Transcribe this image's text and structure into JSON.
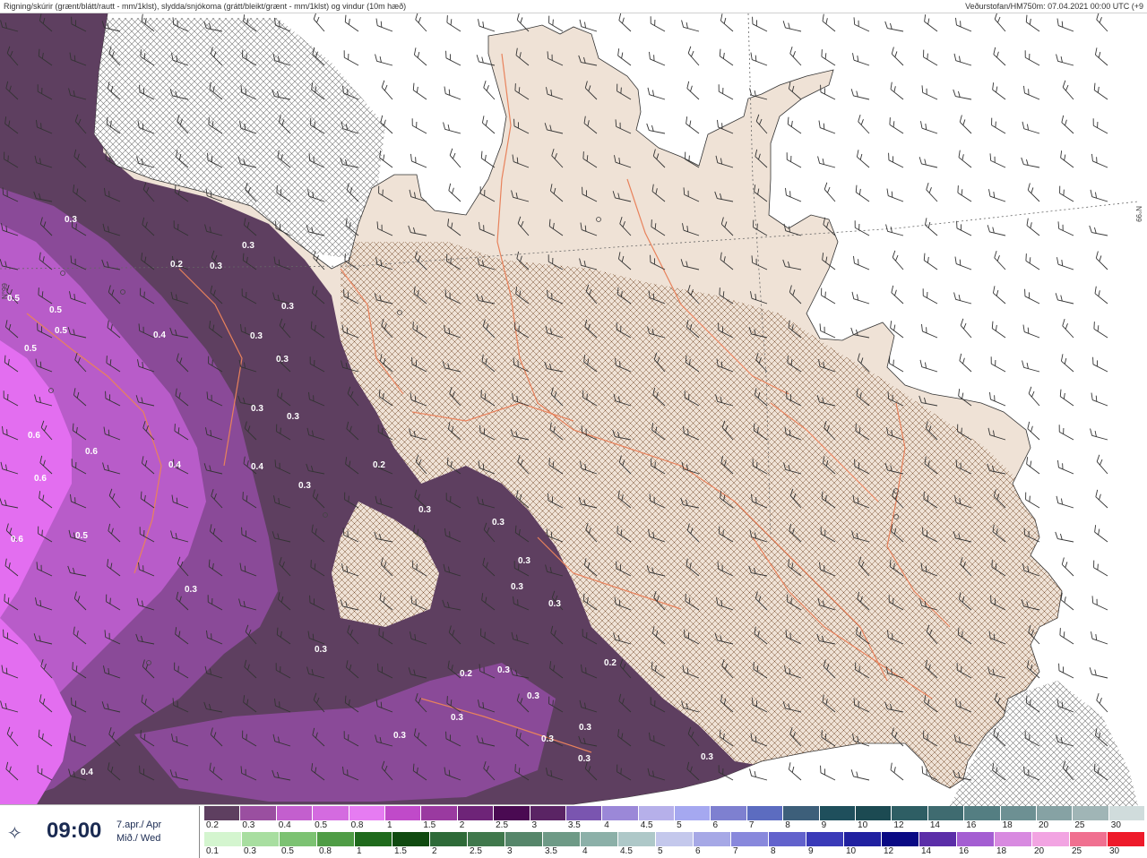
{
  "header": {
    "title": "Rigning/skúrir (grænt/blátt/rautt - mm/1klst), slydda/snjókoma (grátt/bleikt/grænt - mm/1klst) og vindur (10m hæð)",
    "source": "Veðurstofan/HM750m: 07.04.2021 00:00 UTC (+9"
  },
  "time": {
    "hour": "09:00",
    "date_line1": "7.apr./ Apr",
    "date_line2": "Mið./ Wed",
    "icon": "compass-rose-icon"
  },
  "map": {
    "latitude_label": "N°99",
    "values": [
      "0.3",
      "0.2",
      "0.3",
      "0.3",
      "0.5",
      "0.5",
      "0.5",
      "0.5",
      "0.4",
      "0.3",
      "0.3",
      "0.3",
      "0.6",
      "0.6",
      "0.4",
      "0.4",
      "0.6",
      "0.2",
      "0.3",
      "0.6",
      "0.5",
      "0.3",
      "0.3",
      "0.3",
      "0.3",
      "0.3",
      "0.3",
      "0.3",
      "0.2",
      "0.2",
      "0.3",
      "0.3",
      "0.3",
      "0.3",
      "0.3",
      "0.3",
      "0.3",
      "0.3",
      "0.3",
      "0.3",
      "0.4"
    ],
    "colors": {
      "land": "#efe2d6",
      "sea": "#ffffff",
      "roads": "#e8825c",
      "precip_light": "#5e3f60",
      "precip_mid": "#8a4a98",
      "precip_high": "#b85cc9",
      "precip_max": "#e36ef0"
    }
  },
  "legend_snow": {
    "labels": [
      "0.2",
      "0.3",
      "0.4",
      "0.5",
      "0.8",
      "1",
      "1.5",
      "2",
      "2.5",
      "3",
      "3.5",
      "4",
      "4.5",
      "5",
      "6",
      "7",
      "8",
      "9",
      "10",
      "12",
      "14",
      "16",
      "18",
      "20",
      "25",
      "30"
    ],
    "colors": [
      "#5e3f60",
      "#9a4fa0",
      "#c35fce",
      "#d46be0",
      "#e67cf2",
      "#c04ac9",
      "#9a3aa0",
      "#6e2478",
      "#4a0a52",
      "#5a2464",
      "#7a55b0",
      "#9b88d8",
      "#b6b0ea",
      "#a5a8f0",
      "#7e80d0",
      "#5c6cc0",
      "#3d5f7a",
      "#1f4f5c",
      "#1c4a52",
      "#2e5e64",
      "#3f6b70",
      "#547e82",
      "#6d9093",
      "#86a2a4",
      "#a0b5b6",
      "#d0dcdc"
    ]
  },
  "legend_rain": {
    "labels": [
      "0.1",
      "0.3",
      "0.5",
      "0.8",
      "1",
      "1.5",
      "2",
      "2.5",
      "3",
      "3.5",
      "4",
      "4.5",
      "5",
      "6",
      "7",
      "8",
      "9",
      "10",
      "12",
      "14",
      "16",
      "18",
      "20",
      "25",
      "30"
    ],
    "colors": [
      "#d4f5cf",
      "#a8dea0",
      "#7cc272",
      "#4f9c45",
      "#1f6a1c",
      "#104a10",
      "#2e6a38",
      "#40784c",
      "#56866a",
      "#6e9a86",
      "#8cb0a8",
      "#aec8c8",
      "#c4c8ec",
      "#a6a8e6",
      "#8888dc",
      "#6262cc",
      "#3a3ab8",
      "#2020a0",
      "#0a0a84",
      "#5b2ea8",
      "#a45ed2",
      "#d88ae0",
      "#f2a4e2",
      "#f07090",
      "#ee1a2a"
    ]
  }
}
